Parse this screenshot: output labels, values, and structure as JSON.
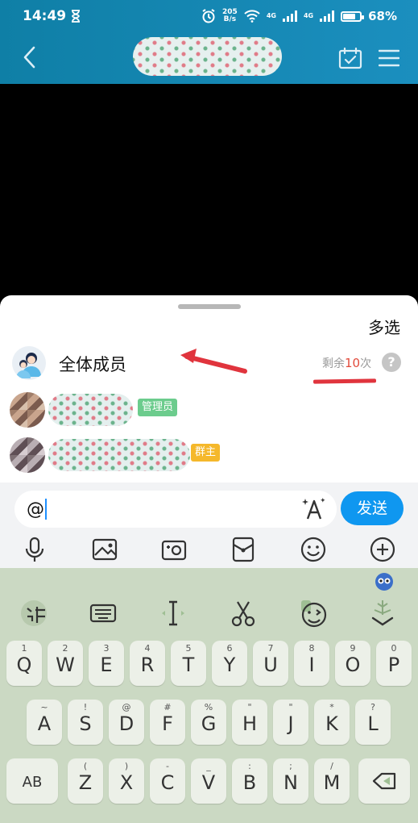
{
  "status_bar": {
    "time": "14:49",
    "net_speed_value": "205",
    "net_speed_unit": "B/s",
    "signal_label_1": "4G",
    "signal_label_2": "4G",
    "battery": "68%"
  },
  "member_panel": {
    "multi_select": "多选",
    "all_members": "全体成员",
    "remaining_prefix": "剩余",
    "remaining_count": "10",
    "remaining_suffix": "次",
    "help": "?",
    "members": [
      {
        "tag": "管理员"
      },
      {
        "tag": "群主"
      }
    ]
  },
  "input": {
    "value": "@",
    "send": "发送"
  },
  "keyboard": {
    "row1": [
      {
        "sub": "1",
        "main": "Q"
      },
      {
        "sub": "2",
        "main": "W"
      },
      {
        "sub": "3",
        "main": "E"
      },
      {
        "sub": "4",
        "main": "R"
      },
      {
        "sub": "5",
        "main": "T"
      },
      {
        "sub": "6",
        "main": "Y"
      },
      {
        "sub": "7",
        "main": "U"
      },
      {
        "sub": "8",
        "main": "I"
      },
      {
        "sub": "9",
        "main": "O"
      },
      {
        "sub": "0",
        "main": "P"
      }
    ],
    "row2": [
      {
        "sub": "~",
        "main": "A"
      },
      {
        "sub": "!",
        "main": "S"
      },
      {
        "sub": "@",
        "main": "D"
      },
      {
        "sub": "#",
        "main": "F"
      },
      {
        "sub": "%",
        "main": "G"
      },
      {
        "sub": "\"",
        "main": "H"
      },
      {
        "sub": "\"",
        "main": "J"
      },
      {
        "sub": "*",
        "main": "K"
      },
      {
        "sub": "?",
        "main": "L"
      }
    ],
    "row3": [
      {
        "sub": "(",
        "main": "Z"
      },
      {
        "sub": ")",
        "main": "X"
      },
      {
        "sub": "-",
        "main": "C"
      },
      {
        "sub": "_",
        "main": "V"
      },
      {
        "sub": ":",
        "main": "B"
      },
      {
        "sub": ";",
        "main": "N"
      },
      {
        "sub": "/",
        "main": "M"
      }
    ],
    "shift": "AB"
  },
  "colors": {
    "header": "#1388b4",
    "send": "#0f97f0",
    "keyboard": "#cbd9c3",
    "annotation": "#e0343d"
  }
}
